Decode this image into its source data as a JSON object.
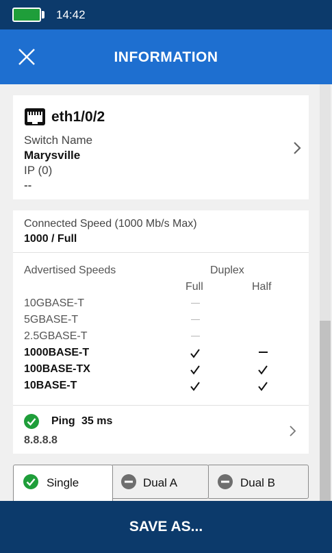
{
  "status_bar": {
    "time": "14:42",
    "battery_color": "#1f9e3a"
  },
  "header": {
    "title": "INFORMATION",
    "close_icon": "close-icon",
    "background": "#1e6fd0"
  },
  "port": {
    "name": "eth1/0/2",
    "icon": "ethernet-port-icon",
    "switch_name_label": "Switch Name",
    "switch_name": "Marysville",
    "ip_label": "IP (0)",
    "ip_value": "--"
  },
  "link": {
    "connected_speed_label": "Connected Speed (1000 Mb/s Max)",
    "connected_speed_value": "1000 / Full",
    "advertised_label": "Advertised Speeds",
    "duplex_label": "Duplex",
    "full_label": "Full",
    "half_label": "Half",
    "speeds": [
      {
        "name": "10GBASE-T",
        "full": "not-supported",
        "half": "none"
      },
      {
        "name": "5GBASE-T",
        "full": "not-supported",
        "half": "none"
      },
      {
        "name": "2.5GBASE-T",
        "full": "not-supported",
        "half": "none"
      },
      {
        "name": "1000BASE-T",
        "full": "check",
        "half": "dash"
      },
      {
        "name": "100BASE-TX",
        "full": "check",
        "half": "check"
      },
      {
        "name": "10BASE-T",
        "full": "check",
        "half": "check"
      }
    ]
  },
  "ping": {
    "label": "Ping",
    "time": "35 ms",
    "address": "8.8.8.8",
    "status_icon": "check-circle-icon",
    "status_color": "#1f9e3a"
  },
  "tabs": [
    {
      "label": "Single",
      "icon": "check-circle-icon",
      "active": true
    },
    {
      "label": "Dual A",
      "icon": "minus-circle-icon",
      "active": false
    },
    {
      "label": "Dual B",
      "icon": "minus-circle-icon",
      "active": false
    }
  ],
  "footer": {
    "save_label": "SAVE AS..."
  }
}
